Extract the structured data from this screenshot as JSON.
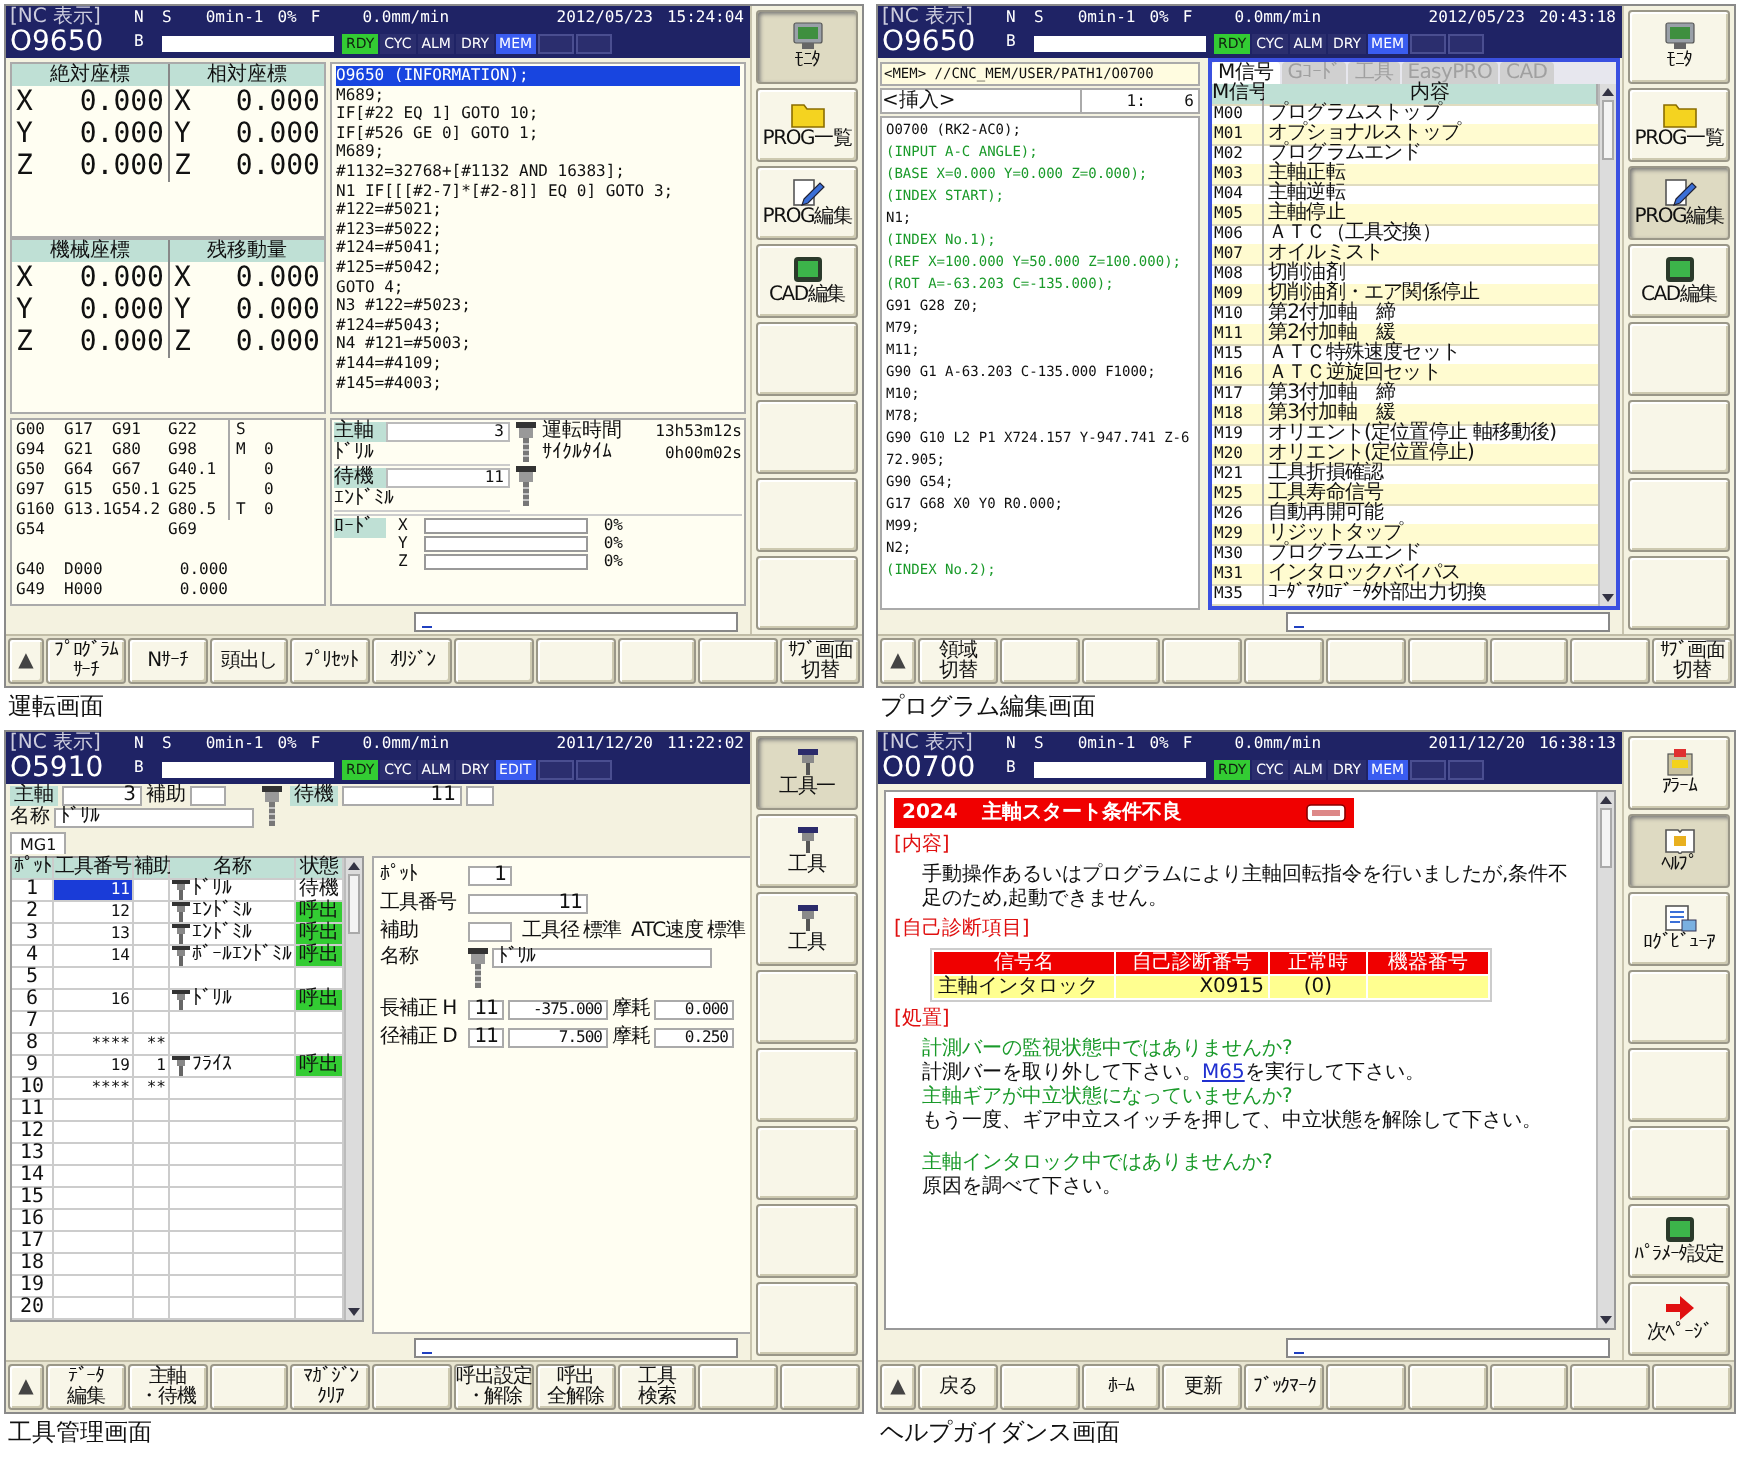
{
  "screens": [
    {
      "kind": "operation",
      "caption": "運転画面",
      "header": {
        "label": "[NC 表示]",
        "program": "O9650",
        "n": "N",
        "b": "B",
        "s": "S",
        "spindle_speed": "0min-1",
        "override": "0%",
        "f": "F",
        "feed": "0.0mm/min",
        "date": "2012/05/23",
        "time": "15:24:04",
        "indicators": [
          {
            "label": "RDY",
            "color": "#33cc33"
          },
          {
            "label": "CYC",
            "color": "#2b2e6e"
          },
          {
            "label": "ALM",
            "color": "#2b2e6e"
          },
          {
            "label": "DRY",
            "color": "#2b2e6e"
          },
          {
            "label": "MEM",
            "color": "#3a5cf0"
          }
        ]
      },
      "content": {
        "coordinate_blocks": [
          {
            "columns": [
              {
                "title": "絶対座標",
                "rows": [
                  {
                    "axis": "X",
                    "value": "0.000"
                  },
                  {
                    "axis": "Y",
                    "value": "0.000"
                  },
                  {
                    "axis": "Z",
                    "value": "0.000"
                  }
                ]
              },
              {
                "title": "相対座標",
                "rows": [
                  {
                    "axis": "X",
                    "value": "0.000"
                  },
                  {
                    "axis": "Y",
                    "value": "0.000"
                  },
                  {
                    "axis": "Z",
                    "value": "0.000"
                  }
                ]
              }
            ]
          },
          {
            "columns": [
              {
                "title": "機械座標",
                "rows": [
                  {
                    "axis": "X",
                    "value": "0.000"
                  },
                  {
                    "axis": "Y",
                    "value": "0.000"
                  },
                  {
                    "axis": "Z",
                    "value": "0.000"
                  }
                ]
              },
              {
                "title": "残移動量",
                "rows": [
                  {
                    "axis": "X",
                    "value": "0.000"
                  },
                  {
                    "axis": "Y",
                    "value": "0.000"
                  },
                  {
                    "axis": "Z",
                    "value": "0.000"
                  }
                ]
              }
            ]
          }
        ],
        "program": {
          "title": "O9650 (INFORMATION);",
          "lines": [
            "M689;",
            "IF[#22 EQ 1] GOTO 10;",
            "IF[#526 GE 0] GOTO 1;",
            "M689;",
            "#1132=32768+[#1132 AND 16383];",
            "N1 IF[[[#2-7]*[#2-8]] EQ 0] GOTO 3;",
            "#122=#5021;",
            "#123=#5022;",
            "#124=#5041;",
            "#125=#5042;",
            "GOTO 4;",
            "N3 #122=#5023;",
            "#124=#5043;",
            "N4 #121=#5003;",
            "#144=#4109;",
            "#145=#4003;"
          ]
        },
        "modal_codes": [
          {
            "column_1": "G00",
            "column_2": "G17",
            "column_3": "G91",
            "column_4": "G22"
          },
          {
            "column_1": "G94",
            "column_2": "G21",
            "column_3": "G80",
            "column_4": "G98"
          },
          {
            "column_1": "G50",
            "column_2": "G64",
            "column_3": "G67",
            "column_4": "G40.1"
          },
          {
            "column_1": "G97",
            "column_2": "G15",
            "column_3": "G50.1",
            "column_4": "G25"
          },
          {
            "column_1": "G160",
            "column_2": "G13.1",
            "column_3": "G54.2",
            "column_4": "G80.5"
          },
          {
            "column_1": "G54",
            "column_4": "G69"
          }
        ],
        "spindle_codes": [
          {
            "label": "S"
          },
          {
            "label": "M",
            "value": "0"
          },
          {
            "value": "0"
          },
          {
            "value": "0"
          },
          {
            "label": "T",
            "value": "0"
          }
        ],
        "offsets": [
          {
            "code": "G40",
            "number": "D000",
            "value": "0.000"
          },
          {
            "code": "G49",
            "number": "H000",
            "value": "0.000"
          }
        ],
        "tool_status": {
          "spindle": {
            "label": "主軸",
            "value": "3",
            "name": "ﾄﾞﾘﾙ"
          },
          "standby": {
            "label": "待機",
            "value": "11",
            "name": "ｴﾝﾄﾞﾐﾙ"
          },
          "times": [
            {
              "label": "運転時間",
              "value": "13h53m12s"
            },
            {
              "label": "ｻｲｸﾙﾀｲﾑ",
              "value": "0h00m02s"
            }
          ],
          "load": {
            "label": "ﾛｰﾄﾞ",
            "axes": [
              {
                "axis": "X",
                "level": 0,
                "reading": "0%"
              },
              {
                "axis": "Y",
                "level": 0,
                "reading": "0%"
              },
              {
                "axis": "Z",
                "level": 0,
                "reading": "0%"
              }
            ]
          }
        }
      },
      "side_keys": [
        {
          "kind": "monitor",
          "label": "ﾓﾆﾀ",
          "selected": true
        },
        {
          "kind": "folder",
          "label": "PROG一覧",
          "selected": false
        },
        {
          "kind": "edit",
          "label": "PROG編集",
          "selected": false
        },
        {
          "kind": "display",
          "label": "CAD編集",
          "selected": false
        },
        {
          "kind": "blank"
        },
        {
          "kind": "blank"
        },
        {
          "kind": "blank"
        },
        {
          "kind": "blank"
        }
      ],
      "page_key": "▲",
      "soft_keys": [
        {
          "kind": "key",
          "lines": [
            "ﾌﾟﾛｸﾞﾗﾑ",
            "ｻｰﾁ"
          ]
        },
        {
          "kind": "key",
          "lines": [
            "Nｻｰﾁ"
          ]
        },
        {
          "kind": "key",
          "lines": [
            "頭出し"
          ]
        },
        {
          "kind": "key",
          "lines": [
            "ﾌﾟﾘｾｯﾄ"
          ]
        },
        {
          "kind": "key",
          "lines": [
            "ｵﾘｼﾞﾝ"
          ]
        },
        {
          "kind": "blank"
        },
        {
          "kind": "blank"
        },
        {
          "kind": "blank"
        },
        {
          "kind": "blank"
        },
        {
          "kind": "key",
          "lines": [
            "ｻﾌﾞ画面",
            "切替"
          ]
        }
      ]
    },
    {
      "kind": "program_edit",
      "caption": "プログラム編集画面",
      "header": {
        "label": "[NC 表示]",
        "program": "O9650",
        "n": "N",
        "b": "B",
        "s": "S",
        "spindle_speed": "0min-1",
        "override": "0%",
        "f": "F",
        "feed": "0.0mm/min",
        "date": "2012/05/23",
        "time": "20:43:18",
        "indicators": [
          {
            "label": "RDY",
            "color": "#33cc33"
          },
          {
            "label": "CYC",
            "color": "#2b2e6e"
          },
          {
            "label": "ALM",
            "color": "#2b2e6e"
          },
          {
            "label": "DRY",
            "color": "#2b2e6e"
          },
          {
            "label": "MEM",
            "color": "#3a5cf0"
          }
        ]
      },
      "content": {
        "path": "<MEM> //CNC_MEM/USER/PATH1/O0700",
        "mode": "<挿入>",
        "position": "1:    6",
        "lines": [
          {
            "kind": "code",
            "text": "O0700 (RK2-AC0);"
          },
          {
            "kind": "comment",
            "text": "(INPUT A-C ANGLE);"
          },
          {
            "kind": "comment",
            "text": "(BASE X=0.000 Y=0.000 Z=0.000);"
          },
          {
            "kind": "comment",
            "text": "(INDEX START);"
          },
          {
            "kind": "code",
            "text": "N1;"
          },
          {
            "kind": "comment",
            "text": "(INDEX No.1);"
          },
          {
            "kind": "comment",
            "text": "(REF X=100.000 Y=50.000 Z=100.000);"
          },
          {
            "kind": "comment",
            "text": "(ROT A=-63.203 C=-135.000);"
          },
          {
            "kind": "code",
            "text": "G91 G28 Z0;"
          },
          {
            "kind": "code",
            "text": "M79;"
          },
          {
            "kind": "code",
            "text": "M11;"
          },
          {
            "kind": "code",
            "text": "G90 G1 A-63.203 C-135.000 F1000;"
          },
          {
            "kind": "code",
            "text": "M10;"
          },
          {
            "kind": "code",
            "text": "M78;"
          },
          {
            "kind": "code",
            "text": "G90 G10 L2 P1 X724.157 Y-947.741 Z-6"
          },
          {
            "kind": "code",
            "text": "72.905;"
          },
          {
            "kind": "code",
            "text": "G90 G54;"
          },
          {
            "kind": "code",
            "text": "G17 G68 X0 Y0 R0.000;"
          },
          {
            "kind": "code",
            "text": "M99;"
          },
          {
            "kind": "code",
            "text": "N2;"
          },
          {
            "kind": "comment",
            "text": "(INDEX No.2);"
          }
        ],
        "help_panel": {
          "tabs": [
            {
              "label": "M信号",
              "selected": true
            },
            {
              "label": "Gｺｰﾄﾞ",
              "selected": false
            },
            {
              "label": "工具",
              "selected": false
            },
            {
              "label": "EasyPRO",
              "selected": false
            },
            {
              "label": "CAD",
              "selected": false
            }
          ],
          "columns": [
            "M信号",
            "内容"
          ],
          "rows": [
            {
              "code": "M00",
              "text": "プログラムストップ"
            },
            {
              "code": "M01",
              "text": "オプショナルストップ"
            },
            {
              "code": "M02",
              "text": "プログラムエンド"
            },
            {
              "code": "M03",
              "text": "主軸正転"
            },
            {
              "code": "M04",
              "text": "主軸逆転"
            },
            {
              "code": "M05",
              "text": "主軸停止"
            },
            {
              "code": "M06",
              "text": "ＡＴＣ（工具交換）"
            },
            {
              "code": "M07",
              "text": "オイルミスト"
            },
            {
              "code": "M08",
              "text": "切削油剤"
            },
            {
              "code": "M09",
              "text": "切削油剤・エア関係停止"
            },
            {
              "code": "M10",
              "text": "第2付加軸　締"
            },
            {
              "code": "M11",
              "text": "第2付加軸　緩"
            },
            {
              "code": "M15",
              "text": "ＡＴＣ特殊速度セット"
            },
            {
              "code": "M16",
              "text": "ＡＴＣ逆旋回セット"
            },
            {
              "code": "M17",
              "text": "第3付加軸　締"
            },
            {
              "code": "M18",
              "text": "第3付加軸　緩"
            },
            {
              "code": "M19",
              "text": "オリエント(定位置停止 軸移動後)"
            },
            {
              "code": "M20",
              "text": "オリエント(定位置停止)"
            },
            {
              "code": "M21",
              "text": "工具折損確認"
            },
            {
              "code": "M25",
              "text": "工具寿命信号"
            },
            {
              "code": "M26",
              "text": "自動再開可能"
            },
            {
              "code": "M29",
              "text": "リジットタップ"
            },
            {
              "code": "M30",
              "text": "プログラムエンド"
            },
            {
              "code": "M31",
              "text": "インタロックバイパス"
            },
            {
              "code": "M35",
              "text": "ｺｰﾀﾞﾏｸﾛﾃﾞｰﾀ外部出力切換"
            }
          ]
        }
      },
      "side_keys": [
        {
          "kind": "monitor",
          "label": "ﾓﾆﾀ",
          "selected": false
        },
        {
          "kind": "folder",
          "label": "PROG一覧",
          "selected": false
        },
        {
          "kind": "edit",
          "label": "PROG編集",
          "selected": true
        },
        {
          "kind": "display",
          "label": "CAD編集",
          "selected": false
        },
        {
          "kind": "blank"
        },
        {
          "kind": "blank"
        },
        {
          "kind": "blank"
        },
        {
          "kind": "blank"
        }
      ],
      "page_key": "▲",
      "soft_keys": [
        {
          "kind": "key",
          "lines": [
            "領域",
            "切替"
          ]
        },
        {
          "kind": "blank"
        },
        {
          "kind": "blank"
        },
        {
          "kind": "blank"
        },
        {
          "kind": "blank"
        },
        {
          "kind": "blank"
        },
        {
          "kind": "blank"
        },
        {
          "kind": "blank"
        },
        {
          "kind": "blank"
        },
        {
          "kind": "key",
          "lines": [
            "ｻﾌﾞ画面",
            "切替"
          ]
        }
      ]
    },
    {
      "kind": "tool_management",
      "caption": "工具管理画面",
      "header": {
        "label": "[NC 表示]",
        "program": "O5910",
        "n": "N",
        "b": "B",
        "s": "S",
        "spindle_speed": "0min-1",
        "override": "0%",
        "f": "F",
        "feed": "0.0mm/min",
        "date": "2011/12/20",
        "time": "11:22:02",
        "indicators": [
          {
            "label": "RDY",
            "color": "#33cc33"
          },
          {
            "label": "CYC",
            "color": "#2b2e6e"
          },
          {
            "label": "ALM",
            "color": "#2b2e6e"
          },
          {
            "label": "DRY",
            "color": "#2b2e6e"
          },
          {
            "label": "EDIT",
            "color": "#3a5cf0"
          }
        ]
      },
      "content": {
        "top": {
          "spindle": {
            "label": "主軸",
            "value": "3"
          },
          "auxiliary": {
            "label": "補助"
          },
          "name": {
            "label": "名称",
            "value": "ﾄﾞﾘﾙ"
          },
          "standby": {
            "label": "待機",
            "value": "11"
          }
        },
        "magazine_tabs": [
          {
            "label": "MG1",
            "selected": true
          }
        ],
        "table": {
          "columns": [
            "ﾎﾟｯﾄ",
            "工具番号",
            "補助",
            "名称",
            "状態"
          ],
          "rows": [
            {
              "pot": "1",
              "tool_number": "11",
              "name": "ﾄﾞﾘﾙ",
              "status": "待機",
              "called": false,
              "selected": true
            },
            {
              "pot": "2",
              "tool_number": "12",
              "name": "ｴﾝﾄﾞﾐﾙ",
              "status": "呼出",
              "called": true,
              "selected": false
            },
            {
              "pot": "3",
              "tool_number": "13",
              "name": "ｴﾝﾄﾞﾐﾙ",
              "status": "呼出",
              "called": true,
              "selected": false
            },
            {
              "pot": "4",
              "tool_number": "14",
              "name": "ﾎﾞｰﾙｴﾝﾄﾞﾐﾙ",
              "status": "呼出",
              "called": true,
              "selected": false
            },
            {
              "pot": "5",
              "selected": false
            },
            {
              "pot": "6",
              "tool_number": "16",
              "name": "ﾄﾞﾘﾙ",
              "status": "呼出",
              "called": true,
              "selected": false
            },
            {
              "pot": "7",
              "selected": false
            },
            {
              "pot": "8",
              "tool_number": "****",
              "auxiliary": "**",
              "selected": false
            },
            {
              "pot": "9",
              "tool_number": "19",
              "auxiliary": "1",
              "name": "ﾌﾗｲｽ",
              "status": "呼出",
              "called": true,
              "selected": false
            },
            {
              "pot": "10",
              "tool_number": "****",
              "auxiliary": "**",
              "selected": false
            },
            {
              "pot": "11",
              "selected": false
            },
            {
              "pot": "12",
              "selected": false
            },
            {
              "pot": "13",
              "selected": false
            },
            {
              "pot": "14",
              "selected": false
            },
            {
              "pot": "15",
              "selected": false
            },
            {
              "pot": "16",
              "selected": false
            },
            {
              "pot": "17",
              "selected": false
            },
            {
              "pot": "18",
              "selected": false
            },
            {
              "pot": "19",
              "selected": false
            },
            {
              "pot": "20",
              "selected": false
            }
          ]
        },
        "detail": {
          "pot": {
            "label": "ﾎﾟｯﾄ",
            "value": "1"
          },
          "tool_number": {
            "label": "工具番号",
            "value": "11"
          },
          "auxiliary": {
            "label": "補助"
          },
          "diameter": {
            "label": "工具径",
            "value": "標準"
          },
          "atc_speed": {
            "label": "ATC速度",
            "value": "標準"
          },
          "name": {
            "label": "名称",
            "value": "ﾄﾞﾘﾙ"
          },
          "offsets": [
            {
              "label": "長補正 H",
              "number": "11",
              "value": "-375.000",
              "wear_label": "摩耗",
              "wear": "0.000"
            },
            {
              "label": "径補正 D",
              "number": "11",
              "value": "7.500",
              "wear_label": "摩耗",
              "wear": "0.250"
            }
          ]
        }
      },
      "side_keys": [
        {
          "kind": "tool",
          "label": "工具一",
          "selected": true
        },
        {
          "kind": "tool",
          "label": "工具",
          "selected": false
        },
        {
          "kind": "tool",
          "label": "工具",
          "selected": false
        },
        {
          "kind": "blank"
        },
        {
          "kind": "blank"
        },
        {
          "kind": "blank"
        },
        {
          "kind": "blank"
        },
        {
          "kind": "blank"
        }
      ],
      "page_key": "▲",
      "soft_keys": [
        {
          "kind": "key",
          "lines": [
            "ﾃﾞｰﾀ",
            "編集"
          ]
        },
        {
          "kind": "key",
          "lines": [
            "主軸",
            "・待機"
          ]
        },
        {
          "kind": "blank"
        },
        {
          "kind": "key",
          "lines": [
            "ﾏｶﾞｼﾞﾝ",
            "ｸﾘｱ"
          ]
        },
        {
          "kind": "blank"
        },
        {
          "kind": "key",
          "lines": [
            "呼出設定",
            "・解除"
          ]
        },
        {
          "kind": "key",
          "lines": [
            "呼出",
            "全解除"
          ]
        },
        {
          "kind": "key",
          "lines": [
            "工具",
            "検索"
          ]
        },
        {
          "kind": "blank"
        },
        {
          "kind": "blank"
        }
      ]
    },
    {
      "kind": "help_guidance",
      "caption": "ヘルプガイダンス画面",
      "header": {
        "label": "[NC 表示]",
        "program": "O0700",
        "n": "N",
        "b": "B",
        "s": "S",
        "spindle_speed": "0min-1",
        "override": "0%",
        "f": "F",
        "feed": "0.0mm/min",
        "date": "2011/12/20",
        "time": "16:38:13",
        "indicators": [
          {
            "label": "RDY",
            "color": "#33cc33"
          },
          {
            "label": "CYC",
            "color": "#2b2e6e"
          },
          {
            "label": "ALM",
            "color": "#2b2e6e"
          },
          {
            "label": "DRY",
            "color": "#2b2e6e"
          },
          {
            "label": "MEM",
            "color": "#3a5cf0"
          }
        ]
      },
      "content": {
        "code": "2024",
        "title": "主軸スタート条件不良",
        "description": {
          "heading": "[内容]",
          "text": "手動操作あるいはプログラムにより主軸回転指令を行いましたが,条件不足のため,起動できません。"
        },
        "diagnosis": {
          "heading": "[自己診断項目]",
          "columns": [
            "信号名",
            "自己診断番号",
            "正常時",
            "機器番号"
          ],
          "rows": [
            {
              "signal": "主軸インタロック",
              "number": "X0915",
              "normal": "(0)"
            }
          ]
        },
        "remedy": {
          "heading": "[処置]",
          "groups": [
            [
              {
                "kind": "question",
                "text": "計測バーの監視状態中ではありませんか?"
              },
              {
                "kind": "answer",
                "parts": [
                  {
                    "text": "計測バーを取り外して下さい。"
                  },
                  {
                    "text": "M65",
                    "link": true
                  },
                  {
                    "text": "を実行して下さい。"
                  }
                ]
              },
              {
                "kind": "question",
                "text": "主軸ギアが中立状態になっていませんか?"
              },
              {
                "kind": "answer",
                "parts": [
                  {
                    "text": "もう一度、ギア中立スイッチを押して、中立状態を解除して下さい。"
                  }
                ]
              }
            ],
            [
              {
                "kind": "question",
                "text": "主軸インタロック中ではありませんか?"
              },
              {
                "kind": "answer",
                "parts": [
                  {
                    "text": "原因を調べて下さい。"
                  }
                ]
              }
            ]
          ]
        }
      },
      "side_keys": [
        {
          "kind": "alarm",
          "label": "ｱﾗｰﾑ",
          "selected": false
        },
        {
          "kind": "help",
          "label": "ﾍﾙﾌﾟ",
          "selected": true
        },
        {
          "kind": "log",
          "label": "ﾛｸﾞﾋﾞｭｰｱ",
          "selected": false
        },
        {
          "kind": "blank"
        },
        {
          "kind": "blank"
        },
        {
          "kind": "blank"
        },
        {
          "kind": "display",
          "label": "ﾊﾟﾗﾒｰﾀ設定",
          "selected": false
        },
        {
          "kind": "next",
          "label": "次ﾍﾟｰｼﾞ",
          "selected": false
        }
      ],
      "page_key": "▲",
      "soft_keys": [
        {
          "kind": "key",
          "lines": [
            "戻る"
          ]
        },
        {
          "kind": "blank"
        },
        {
          "kind": "key",
          "lines": [
            "ﾎｰﾑ"
          ]
        },
        {
          "kind": "key",
          "lines": [
            "更新"
          ]
        },
        {
          "kind": "key",
          "lines": [
            "ﾌﾞｯｸﾏｰｸ"
          ]
        },
        {
          "kind": "blank"
        },
        {
          "kind": "blank"
        },
        {
          "kind": "blank"
        },
        {
          "kind": "blank"
        },
        {
          "kind": "blank"
        }
      ]
    }
  ]
}
